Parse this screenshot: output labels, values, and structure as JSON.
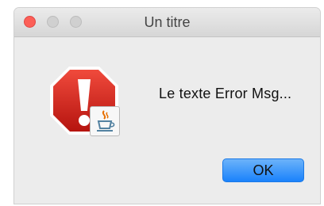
{
  "window": {
    "title": "Un titre"
  },
  "dialog": {
    "message": "Le texte Error Msg...",
    "ok_label": "OK",
    "icon": "error-stop-sign-icon",
    "badge_icon": "java-coffee-icon"
  },
  "colors": {
    "close_light": "#fc5f57",
    "inactive_light": "#d0d0d0",
    "stop_sign": "#d7261f",
    "ok_button": "#1a82fb"
  }
}
